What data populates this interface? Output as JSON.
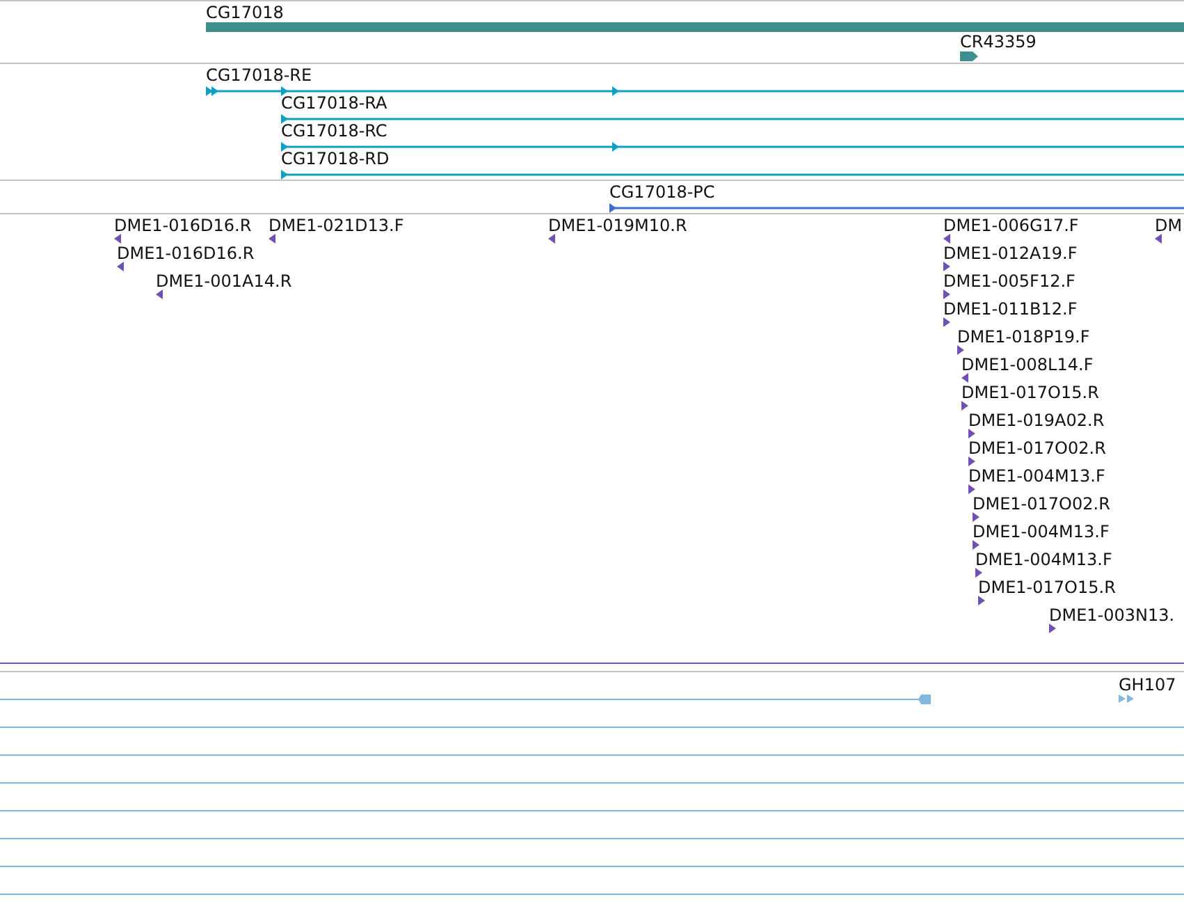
{
  "tracks": [
    {
      "kind": "gene",
      "features": [
        {
          "label": "CG17018"
        },
        {
          "label": "CR43359",
          "reverse": false
        }
      ]
    },
    {
      "kind": "transcript",
      "features": [
        {
          "label": "CG17018-RE",
          "reverse": false
        },
        {
          "label": "CG17018-RA",
          "reverse": false
        },
        {
          "label": "CG17018-RC",
          "reverse": false
        },
        {
          "label": "CG17018-RD",
          "reverse": false
        }
      ]
    },
    {
      "kind": "protein",
      "features": [
        {
          "label": "CG17018-PC",
          "reverse": false
        }
      ]
    },
    {
      "kind": "est",
      "features": [
        {
          "label": "DME1-016D16.R",
          "reverse": true
        },
        {
          "label": "DME1-021D13.F",
          "reverse": true
        },
        {
          "label": "DME1-019M10.R",
          "reverse": true
        },
        {
          "label": "DME1-006G17.F",
          "reverse": true
        },
        {
          "label": "DM",
          "reverse": true
        },
        {
          "label": "DME1-016D16.R",
          "reverse": true
        },
        {
          "label": "DME1-012A19.F",
          "reverse": false
        },
        {
          "label": "DME1-001A14.R",
          "reverse": true
        },
        {
          "label": "DME1-005F12.F",
          "reverse": false
        },
        {
          "label": "DME1-011B12.F",
          "reverse": false
        },
        {
          "label": "DME1-018P19.F",
          "reverse": false
        },
        {
          "label": "DME1-008L14.F",
          "reverse": true
        },
        {
          "label": "DME1-017O15.R",
          "reverse": false
        },
        {
          "label": "DME1-019A02.R",
          "reverse": false
        },
        {
          "label": "DME1-017O02.R",
          "reverse": false
        },
        {
          "label": "DME1-004M13.F",
          "reverse": false
        },
        {
          "label": "DME1-017O02.R",
          "reverse": false
        },
        {
          "label": "DME1-004M13.F",
          "reverse": false
        },
        {
          "label": "DME1-004M13.F",
          "reverse": false
        },
        {
          "label": "DME1-017O15.R",
          "reverse": false
        },
        {
          "label": "DME1-003N13.",
          "reverse": false
        }
      ]
    },
    {
      "kind": "cdna",
      "features": [
        {
          "label": "GH107",
          "reverse": false
        }
      ]
    }
  ]
}
